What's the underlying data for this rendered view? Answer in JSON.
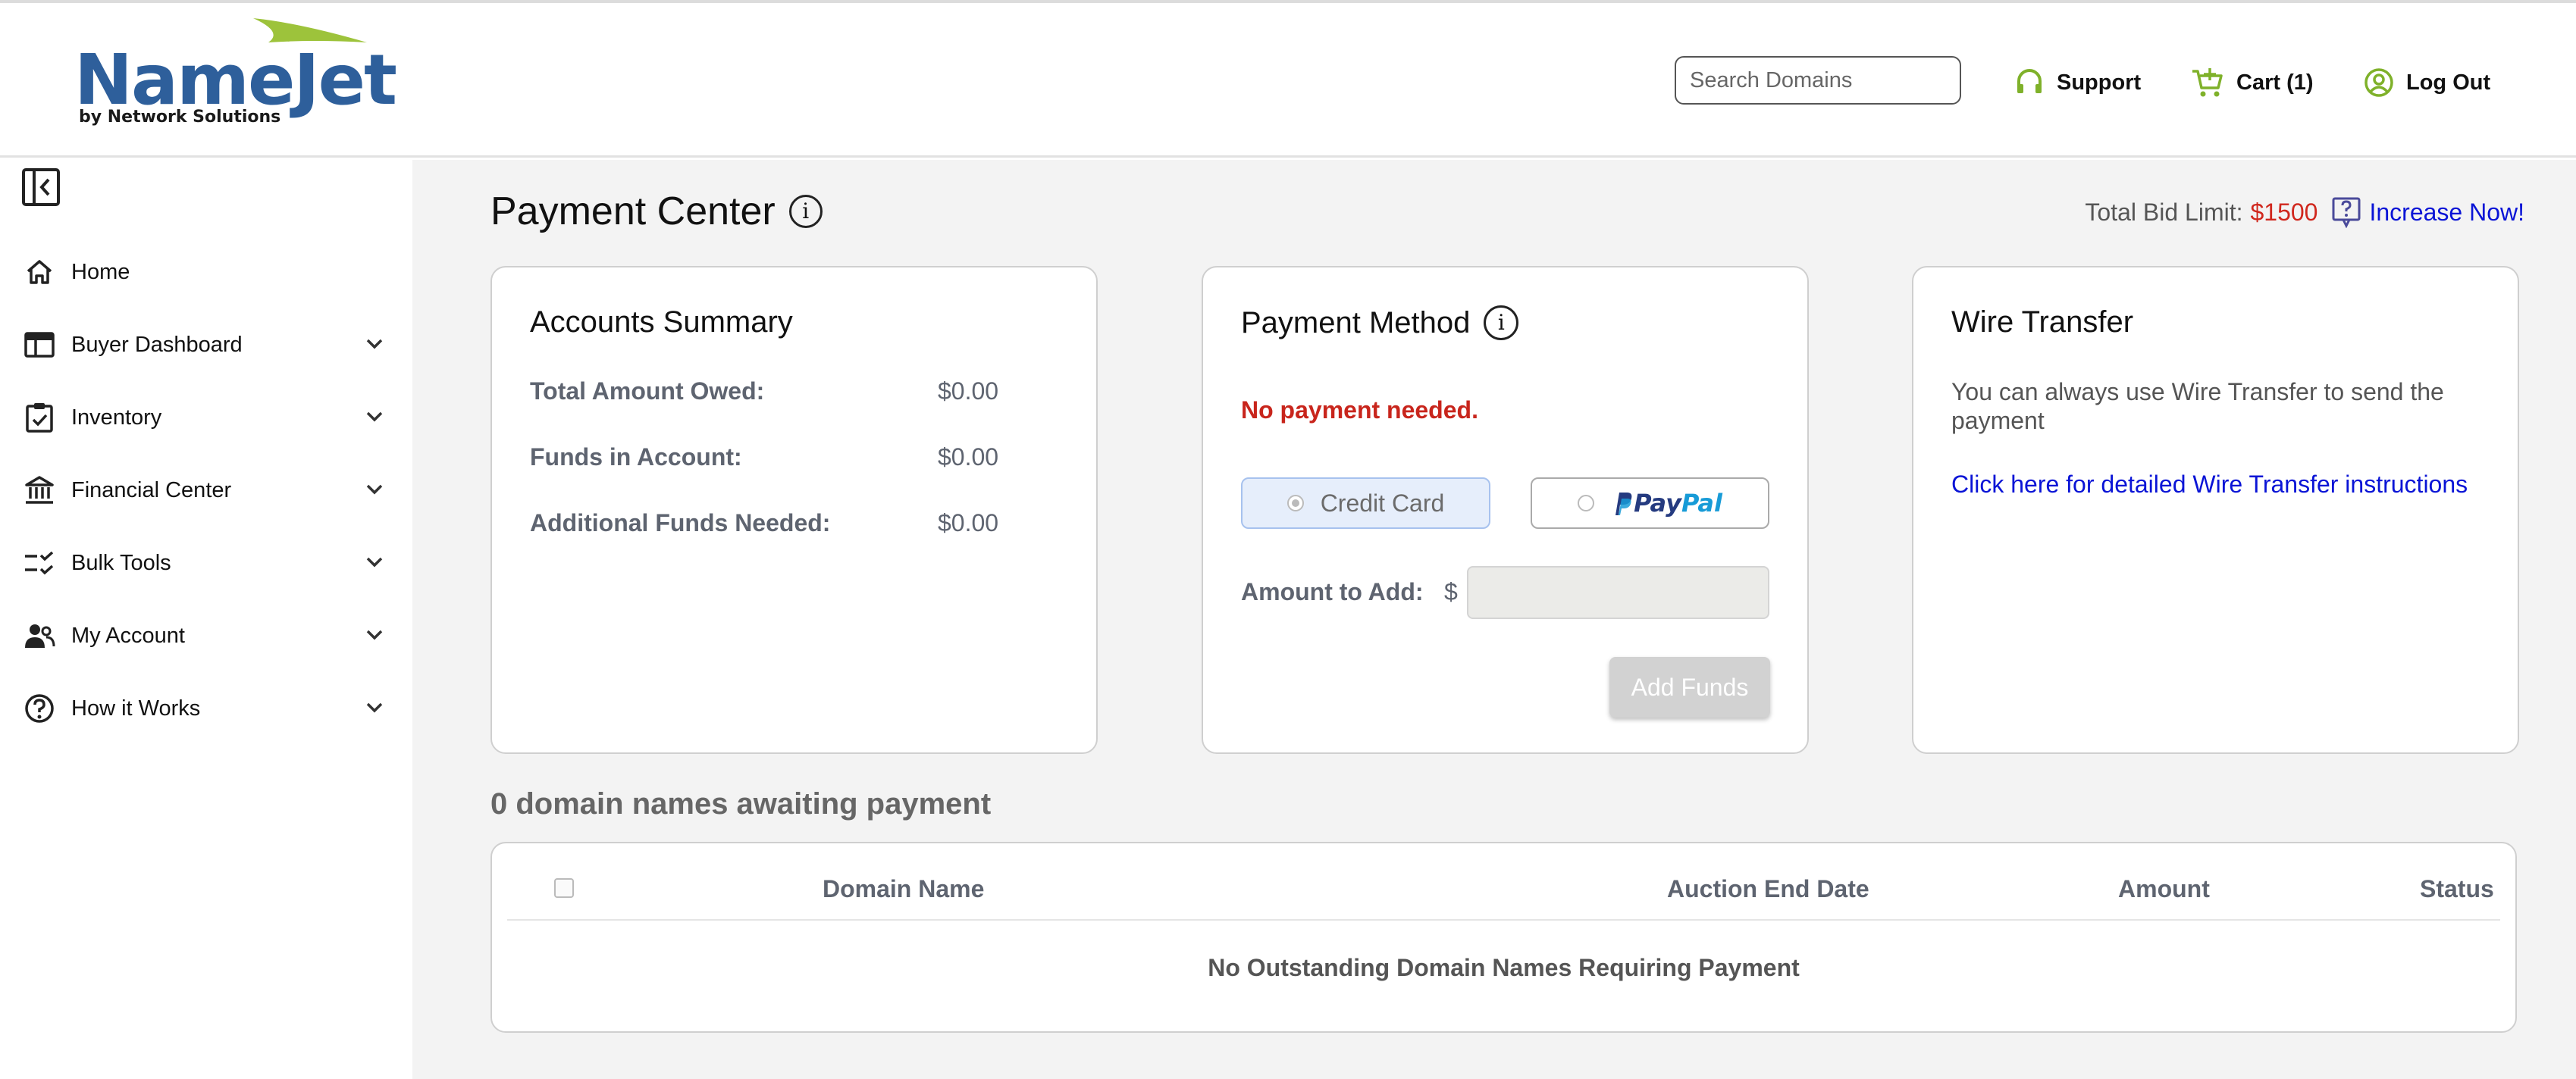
{
  "header": {
    "logo_name": "NameJet",
    "logo_sub": "by Network Solutions",
    "search_placeholder": "Search Domains",
    "support_label": "Support",
    "cart_label": "Cart (1)",
    "logout_label": "Log Out"
  },
  "sidebar": {
    "items": [
      {
        "label": "Home",
        "icon": "home-icon"
      },
      {
        "label": "Buyer Dashboard",
        "icon": "dashboard-icon"
      },
      {
        "label": "Inventory",
        "icon": "clipboard-icon"
      },
      {
        "label": "Financial Center",
        "icon": "bank-icon"
      },
      {
        "label": "Bulk Tools",
        "icon": "checklist-icon"
      },
      {
        "label": "My Account",
        "icon": "users-icon"
      },
      {
        "label": "How it Works",
        "icon": "question-icon"
      }
    ]
  },
  "main": {
    "title": "Payment Center",
    "bid_limit_label": "Total Bid Limit:",
    "bid_limit_amount": "$1500",
    "increase_link": "Increase Now!",
    "accounts_summary": {
      "title": "Accounts Summary",
      "rows": [
        {
          "label": "Total Amount Owed:",
          "value": "$0.00"
        },
        {
          "label": "Funds in Account:",
          "value": "$0.00"
        },
        {
          "label": "Additional Funds Needed:",
          "value": "$0.00"
        }
      ]
    },
    "payment_method": {
      "title": "Payment Method",
      "notice": "No payment needed.",
      "credit_card_label": "Credit Card",
      "paypal_pay": "Pay",
      "paypal_pal": "Pal",
      "amount_label": "Amount to Add:",
      "currency_symbol": "$",
      "amount_value": "",
      "add_funds_label": "Add Funds"
    },
    "wire_transfer": {
      "title": "Wire Transfer",
      "text": "You can always use Wire Transfer to send the payment",
      "link": "Click here for detailed Wire Transfer instructions"
    },
    "awaiting_title": "0 domain names awaiting payment",
    "table": {
      "columns": [
        "Domain Name",
        "Auction End Date",
        "Amount",
        "Status"
      ],
      "empty_message": "No Outstanding Domain Names Requiring Payment"
    }
  },
  "colors": {
    "brand_blue": "#2e5f9b",
    "brand_green": "#9dc33b",
    "alert_red": "#c8251c",
    "link_blue": "#0a14d6"
  }
}
